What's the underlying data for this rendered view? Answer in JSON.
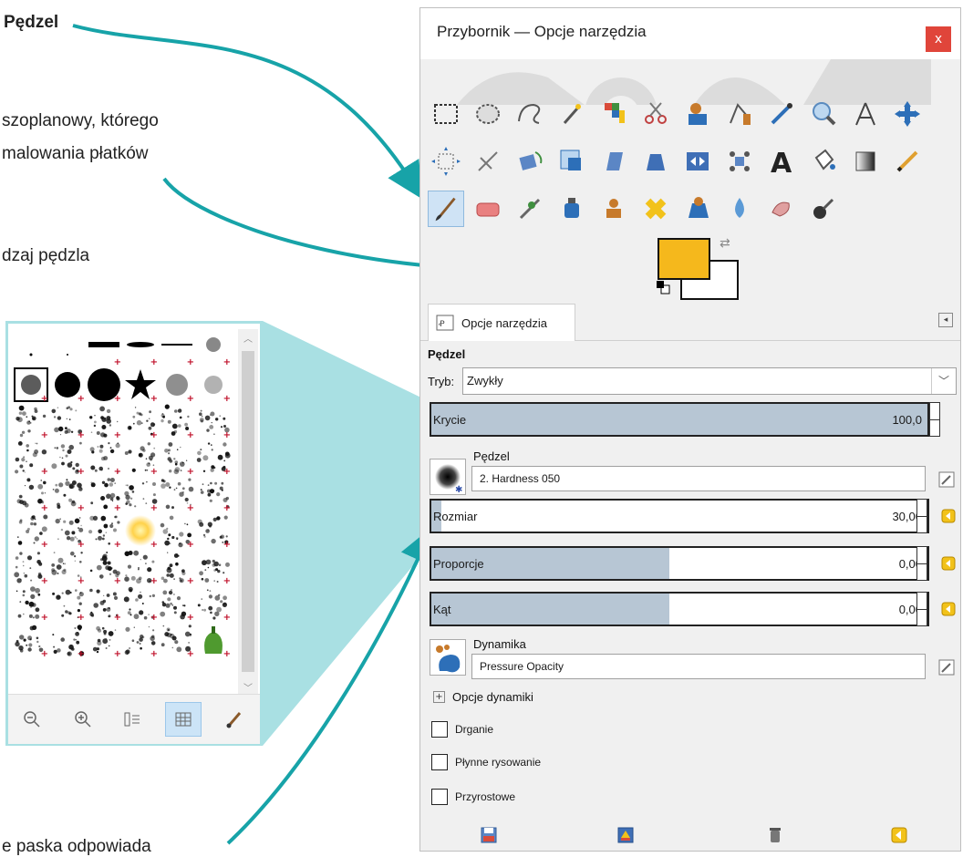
{
  "annotations": {
    "brush_title": "Pędzel",
    "line1": "szoplanowy, którego",
    "line2": "malowania płatków",
    "line3": "dzaj pędzla",
    "bottom": "e paska odpowiada"
  },
  "colors": {
    "accent_arrow": "#17a3a8",
    "callout": "#a9e0e3",
    "foreground": "#f5b81c",
    "slider_fill": "#b7c6d4"
  },
  "window": {
    "title": "Przybornik — Opcje narzędzia",
    "close_label": "x"
  },
  "tools": [
    "rect-select-icon",
    "ellipse-select-icon",
    "free-select-icon",
    "fuzzy-select-icon",
    "color-select-icon",
    "scissors-icon",
    "foreground-select-icon",
    "paths-icon",
    "color-picker-icon",
    "zoom-icon",
    "measure-icon",
    "move-icon",
    "align-icon",
    "crop-icon",
    "rotate-icon",
    "scale-icon",
    "shear-icon",
    "perspective-icon",
    "flip-icon",
    "cage-icon",
    "text-icon",
    "bucket-fill-icon",
    "blend-icon",
    "pencil-icon",
    "paintbrush-icon",
    "eraser-icon",
    "airbrush-icon",
    "ink-icon",
    "clone-icon",
    "heal-icon",
    "perspective-clone-icon",
    "blur-icon",
    "smudge-icon",
    "dodge-burn-icon"
  ],
  "tab": {
    "label": "Opcje narzędzia"
  },
  "options": {
    "section": "Pędzel",
    "mode_label": "Tryb:",
    "mode_value": "Zwykły",
    "opacity": {
      "label": "Krycie",
      "value": "100,0",
      "fraction": 1.0
    },
    "brush_label": "Pędzel",
    "brush_value": "2. Hardness 050",
    "size": {
      "label": "Rozmiar",
      "value": "30,00",
      "fraction": 0.02
    },
    "ratio": {
      "label": "Proporcje",
      "value": "0,00",
      "fraction": 0.48
    },
    "angle": {
      "label": "Kąt",
      "value": "0,00",
      "fraction": 0.48
    },
    "dynamics_label": "Dynamika",
    "dynamics_value": "Pressure Opacity",
    "dynamics_options": "Opcje dynamiki",
    "checks": [
      {
        "label": "Drganie",
        "checked": false
      },
      {
        "label": "Płynne rysowanie",
        "checked": false
      },
      {
        "label": "Przyrostowe",
        "checked": false
      }
    ]
  },
  "popup_toolbar": [
    "zoom-out-icon",
    "zoom-in-icon",
    "list-view-icon",
    "grid-view-icon",
    "edit-brush-icon"
  ]
}
